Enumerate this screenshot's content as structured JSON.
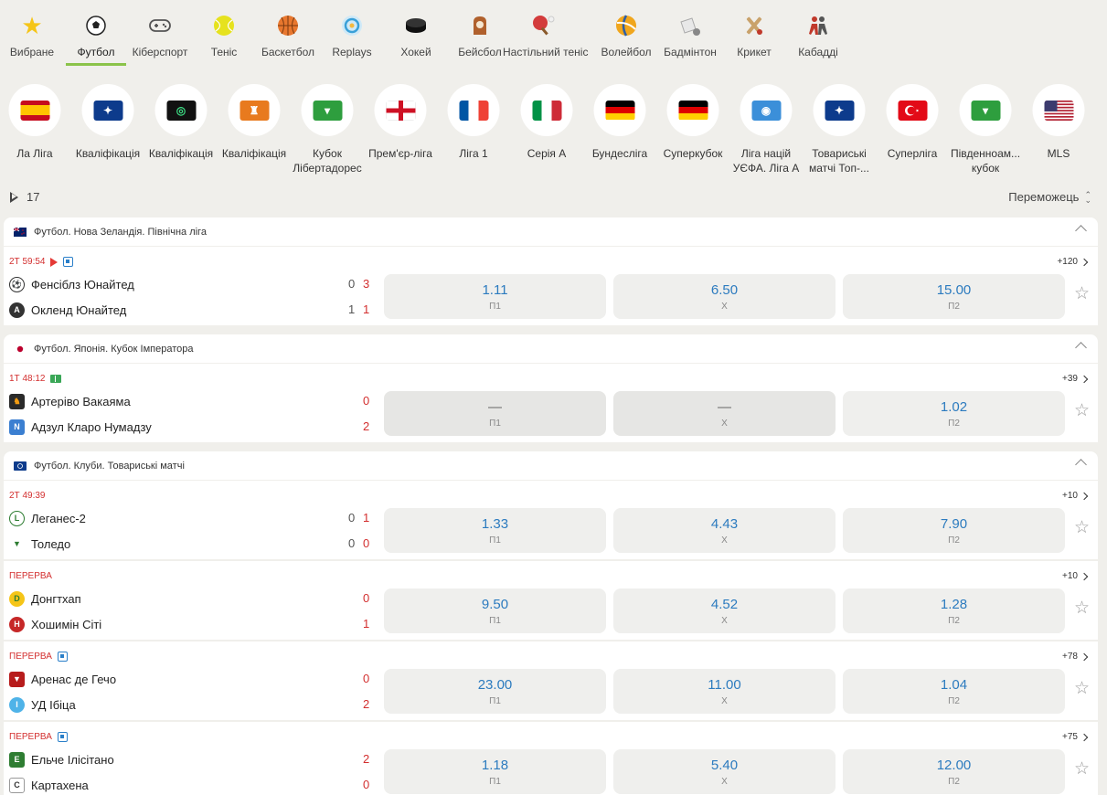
{
  "sports": [
    {
      "label": "Вибране",
      "icon": "star-icon",
      "glyph": "★",
      "color": "#f5c518"
    },
    {
      "label": "Футбол",
      "icon": "soccer-ball-icon",
      "glyph": "⚽",
      "color": "#222222",
      "active": true
    },
    {
      "label": "Кіберспорт",
      "icon": "gamepad-icon",
      "glyph": "🎮",
      "color": "#555555"
    },
    {
      "label": "Теніс",
      "icon": "tennis-ball-icon",
      "glyph": "●",
      "color": "#e3e31c"
    },
    {
      "label": "Баскетбол",
      "icon": "basketball-icon",
      "glyph": "●",
      "color": "#e8772e"
    },
    {
      "label": "Replays",
      "icon": "replay-icon",
      "glyph": "↻",
      "color": "#3aa0d8"
    },
    {
      "label": "Хокей",
      "icon": "hockey-puck-icon",
      "glyph": "⬬",
      "color": "#222222"
    },
    {
      "label": "Бейсбол",
      "icon": "baseball-glove-icon",
      "glyph": "⚾",
      "color": "#b0602c"
    },
    {
      "label": "Настільний теніс",
      "icon": "table-tennis-icon",
      "glyph": "🏓",
      "color": "#d33b3b"
    },
    {
      "label": "Волейбол",
      "icon": "volleyball-icon",
      "glyph": "🏐",
      "color": "#f0a61d"
    },
    {
      "label": "Бадмінтон",
      "icon": "shuttlecock-icon",
      "glyph": "🏸",
      "color": "#999999"
    },
    {
      "label": "Крикет",
      "icon": "cricket-bat-icon",
      "glyph": "🏏",
      "color": "#c0392b"
    },
    {
      "label": "Кабадді",
      "icon": "kabaddi-icon",
      "glyph": "🤼",
      "color": "#c0392b"
    }
  ],
  "leagues": [
    {
      "label": "Ла Ліга",
      "icon": "spain-flag-icon"
    },
    {
      "label": "Кваліфікація",
      "icon": "champions-league-icon"
    },
    {
      "label": "Кваліфікація",
      "icon": "conference-league-icon"
    },
    {
      "label": "Кваліфікація",
      "icon": "europa-league-icon"
    },
    {
      "label": "Кубок\nЛібертадорес",
      "icon": "south-america-icon"
    },
    {
      "label": "Прем'єр-ліга",
      "icon": "england-flag-icon"
    },
    {
      "label": "Ліга 1",
      "icon": "france-flag-icon"
    },
    {
      "label": "Серія А",
      "icon": "italy-flag-icon"
    },
    {
      "label": "Бундесліга",
      "icon": "germany-flag-icon"
    },
    {
      "label": "Суперкубок",
      "icon": "germany-flag-icon"
    },
    {
      "label": "Ліга націй\nУЄФА. Ліга А",
      "icon": "globe-icon"
    },
    {
      "label": "Товариські\nматчі Топ-...",
      "icon": "champions-league-icon"
    },
    {
      "label": "Суперліга",
      "icon": "turkey-flag-icon"
    },
    {
      "label": "Південноам...\nкубок",
      "icon": "south-america-icon"
    },
    {
      "label": "MLS",
      "icon": "usa-flag-icon"
    }
  ],
  "filters": {
    "live_count": "17",
    "sort_label": "Переможець"
  },
  "groups": [
    {
      "title": "Футбол. Нова Зеландія. Північна ліга",
      "icon": "new-zealand-flag-icon",
      "matches": [
        {
          "time": "2Т 59:54",
          "video": true,
          "stream": true,
          "team1": "Фенсіблз Юнайтед",
          "team2": "Окленд Юнайтед",
          "s1": [
            "0",
            "3"
          ],
          "s2": [
            "1",
            "1"
          ],
          "odds": [
            {
              "v": "1.11",
              "k": "П1"
            },
            {
              "v": "6.50",
              "k": "Х"
            },
            {
              "v": "15.00",
              "k": "П2"
            }
          ],
          "more": "+120"
        }
      ]
    },
    {
      "title": "Футбол. Японія. Кубок Імператора",
      "icon": "japan-flag-icon",
      "matches": [
        {
          "time": "1Т 48:12",
          "field": true,
          "team1": "Артеріво Вакаяма",
          "team2": "Адзул Кларо Нумадзу",
          "s1": [
            "",
            "0"
          ],
          "s2": [
            "",
            "2"
          ],
          "odds": [
            {
              "v": "—",
              "k": "П1"
            },
            {
              "v": "—",
              "k": "Х"
            },
            {
              "v": "1.02",
              "k": "П2"
            }
          ],
          "more": "+39"
        }
      ]
    },
    {
      "title": "Футбол. Клуби. Товариські матчі",
      "icon": "champions-league-icon",
      "matches": [
        {
          "time": "2Т 49:39",
          "team1": "Леганес-2",
          "team2": "Толедо",
          "s1": [
            "0",
            "1"
          ],
          "s2": [
            "0",
            "0"
          ],
          "odds": [
            {
              "v": "1.33",
              "k": "П1"
            },
            {
              "v": "4.43",
              "k": "Х"
            },
            {
              "v": "7.90",
              "k": "П2"
            }
          ],
          "more": "+10"
        },
        {
          "time": "ПЕРЕРВА",
          "team1": "Донгтхап",
          "team2": "Хошимін Сіті",
          "s1": [
            "",
            "0"
          ],
          "s2": [
            "",
            "1"
          ],
          "odds": [
            {
              "v": "9.50",
              "k": "П1"
            },
            {
              "v": "4.52",
              "k": "Х"
            },
            {
              "v": "1.28",
              "k": "П2"
            }
          ],
          "more": "+10"
        },
        {
          "time": "ПЕРЕРВА",
          "stream": true,
          "team1": "Аренас де Гечо",
          "team2": "УД Ібіца",
          "s1": [
            "",
            "0"
          ],
          "s2": [
            "",
            "2"
          ],
          "odds": [
            {
              "v": "23.00",
              "k": "П1"
            },
            {
              "v": "11.00",
              "k": "Х"
            },
            {
              "v": "1.04",
              "k": "П2"
            }
          ],
          "more": "+78"
        },
        {
          "time": "ПЕРЕРВА",
          "stream": true,
          "team1": "Ельче Ілісітано",
          "team2": "Картахена",
          "s1": [
            "",
            "2"
          ],
          "s2": [
            "",
            "0"
          ],
          "odds": [
            {
              "v": "1.18",
              "k": "П1"
            },
            {
              "v": "5.40",
              "k": "Х"
            },
            {
              "v": "12.00",
              "k": "П2"
            }
          ],
          "more": "+75"
        }
      ]
    }
  ]
}
